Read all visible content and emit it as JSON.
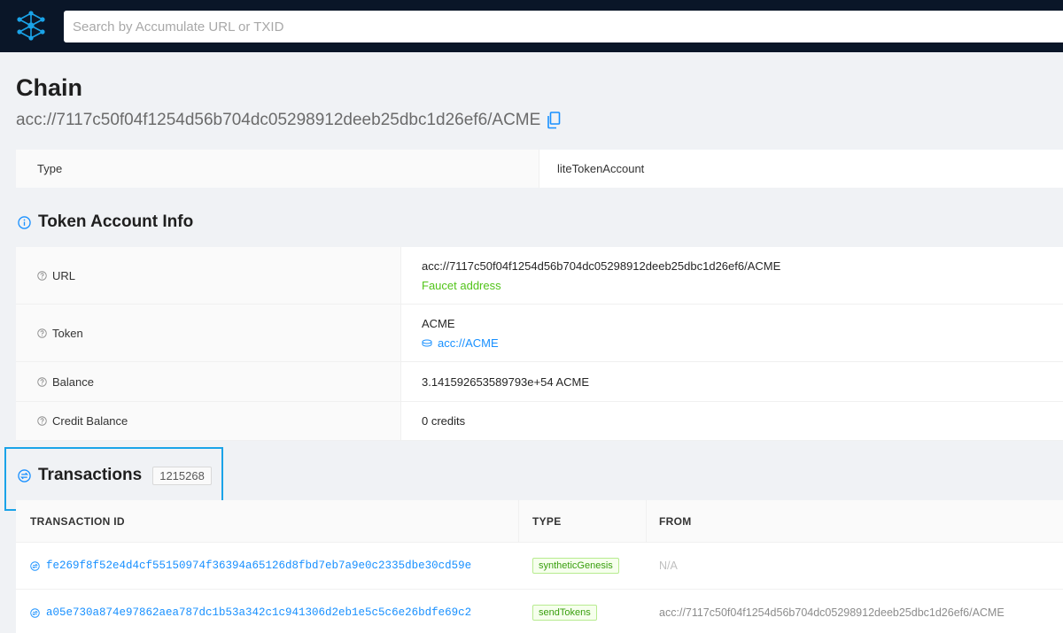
{
  "header": {
    "logo_icon": "accumulate-network-logo-icon",
    "search_placeholder": "Search by Accumulate URL or TXID"
  },
  "page": {
    "title": "Chain",
    "url": "acc://7117c50f04f1254d56b704dc05298912deeb25dbc1d26ef6/ACME",
    "copy_icon": "copy-icon"
  },
  "type_row": {
    "label": "Type",
    "value": "liteTokenAccount"
  },
  "token_info": {
    "title": "Token Account Info",
    "rows": [
      {
        "label": "URL",
        "value": "acc://7117c50f04f1254d56b704dc05298912deeb25dbc1d26ef6/ACME",
        "sub": "Faucet address"
      },
      {
        "label": "Token",
        "value": "ACME",
        "sub": "acc://ACME"
      },
      {
        "label": "Balance",
        "value": "3.141592653589793e+54 ACME"
      },
      {
        "label": "Credit Balance",
        "value": "0 credits"
      }
    ]
  },
  "transactions": {
    "title": "Transactions",
    "count": "1215268",
    "columns": [
      "TRANSACTION ID",
      "TYPE",
      "FROM"
    ],
    "rows": [
      {
        "id": "fe269f8f52e4d4cf55150974f36394a65126d8fbd7eb7a9e0c2335dbe30cd59e",
        "type": "syntheticGenesis",
        "from": "N/A"
      },
      {
        "id": "a05e730a874e97862aea787dc1b53a342c1c941306d2eb1e5c5c6e26bdfe69c2",
        "type": "sendTokens",
        "from": "acc://7117c50f04f1254d56b704dc05298912deeb25dbc1d26ef6/ACME"
      }
    ]
  },
  "colors": {
    "topbar": "#0a1628",
    "link": "#1890ff",
    "success": "#52c41a",
    "highlight": "#1aa3e8"
  }
}
